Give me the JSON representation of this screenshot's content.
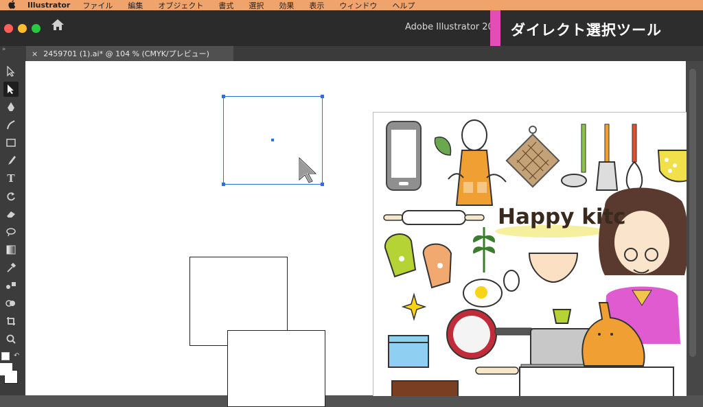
{
  "menubar": {
    "apple": "",
    "app_name": "Illustrator",
    "items": [
      "ファイル",
      "編集",
      "オブジェクト",
      "書式",
      "選択",
      "効果",
      "表示",
      "ウィンドウ",
      "ヘルプ"
    ]
  },
  "window": {
    "title": "Adobe Illustrator 20"
  },
  "caption": {
    "text": "ダイレクト選択ツール",
    "accent_color": "#e44cb8"
  },
  "document_tab": {
    "close": "×",
    "label": "2459701 (1).ai* @ 104 % (CMYK/プレビュー)"
  },
  "toolbar": {
    "tools": [
      {
        "icon": "selection-tool-icon"
      },
      {
        "icon": "direct-selection-tool-icon",
        "selected": true
      },
      {
        "icon": "pen-tool-icon"
      },
      {
        "icon": "curvature-tool-icon"
      },
      {
        "icon": "rectangle-tool-icon"
      },
      {
        "icon": "paintbrush-tool-icon"
      },
      {
        "icon": "type-tool-icon"
      },
      {
        "icon": "rotate-tool-icon"
      },
      {
        "icon": "eraser-tool-icon"
      },
      {
        "icon": "lasso-tool-icon"
      },
      {
        "icon": "gradient-tool-icon"
      },
      {
        "icon": "eyedropper-tool-icon"
      },
      {
        "icon": "blend-tool-icon"
      },
      {
        "icon": "shape-builder-tool-icon"
      },
      {
        "icon": "crop-tool-icon"
      },
      {
        "icon": "zoom-tool-icon"
      }
    ]
  },
  "artwork": {
    "title_text": "Happy kitc"
  }
}
